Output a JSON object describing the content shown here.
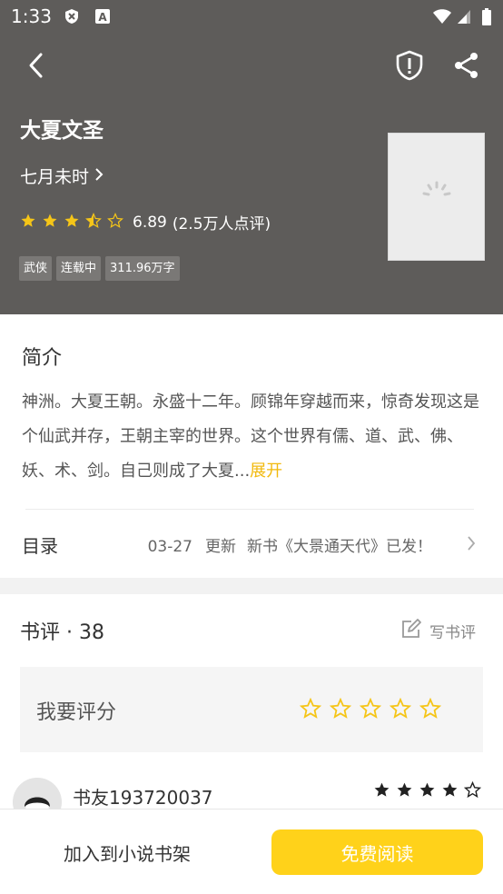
{
  "status_bar": {
    "time": "1:33"
  },
  "book": {
    "title": "大夏文圣",
    "author": "七月未时",
    "rating": "6.89",
    "rating_count": "(2.5万人点评)",
    "star_score": 3.5,
    "tags": [
      "武侠",
      "连载中",
      "311.96万字"
    ]
  },
  "intro": {
    "title": "简介",
    "text": "神洲。大夏王朝。永盛十二年。顾锦年穿越而来，惊奇发现这是个仙武并存，王朝主宰的世界。这个世界有儒、道、武、佛、妖、术、剑。自己则成了大夏...",
    "expand_label": "展开"
  },
  "toc": {
    "label": "目录",
    "date": "03-27",
    "update_word": "更新",
    "latest": "新书《大景通天代》已发！"
  },
  "reviews": {
    "title": "书评 · 38",
    "write_label": "写书评",
    "rate_label": "我要评分",
    "items": [
      {
        "name": "书友193720037",
        "stars": 4
      }
    ]
  },
  "bottom": {
    "add_shelf": "加入到小说书架",
    "read_free": "免费阅读"
  },
  "colors": {
    "header_bg": "#5e5c5a",
    "accent": "#ffd21a",
    "star": "#f5c518"
  },
  "icons": [
    "back-icon",
    "shield-icon",
    "share-icon",
    "chevron-right-icon",
    "edit-icon",
    "star-icon"
  ]
}
